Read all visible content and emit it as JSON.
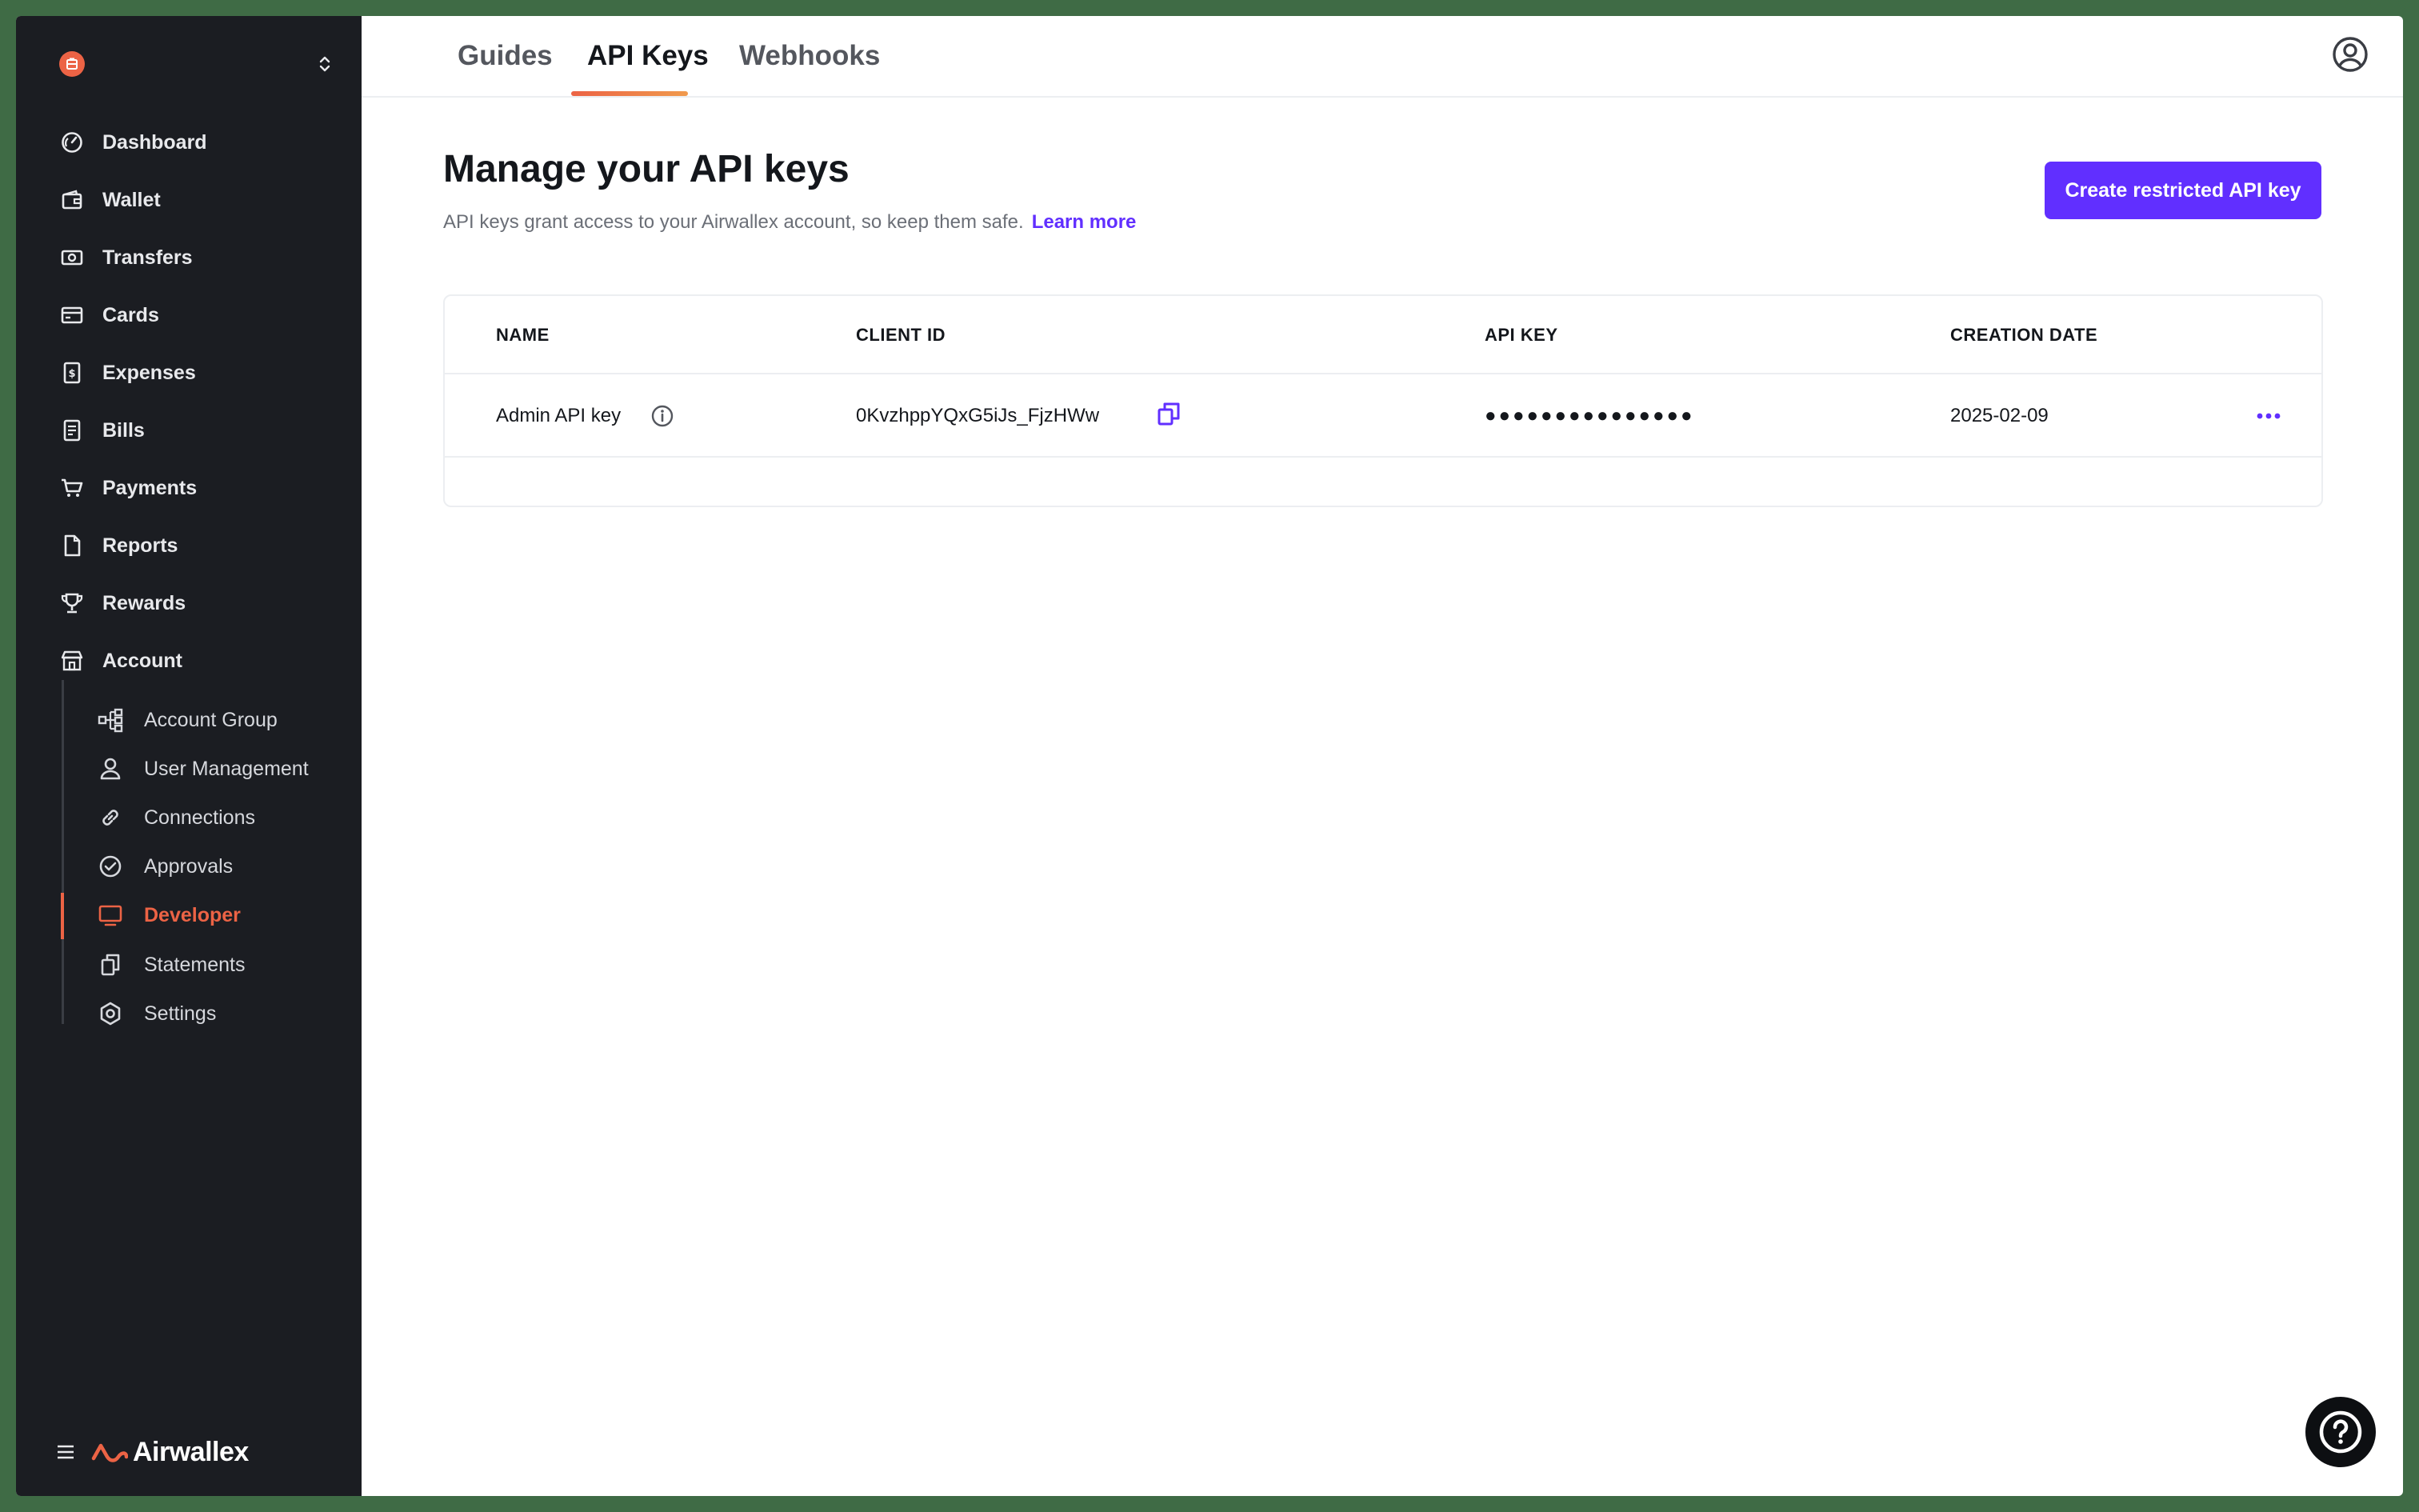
{
  "sidebar": {
    "org_icon": "building-icon",
    "switcher_icon": "chevron-up-down-icon",
    "items": [
      {
        "label": "Dashboard",
        "icon": "gauge-icon"
      },
      {
        "label": "Wallet",
        "icon": "wallet-icon"
      },
      {
        "label": "Transfers",
        "icon": "banknote-icon"
      },
      {
        "label": "Cards",
        "icon": "card-icon"
      },
      {
        "label": "Expenses",
        "icon": "receipt-dollar-icon"
      },
      {
        "label": "Bills",
        "icon": "bill-icon"
      },
      {
        "label": "Payments",
        "icon": "cart-icon"
      },
      {
        "label": "Reports",
        "icon": "document-icon"
      },
      {
        "label": "Rewards",
        "icon": "trophy-icon"
      },
      {
        "label": "Account",
        "icon": "storefront-icon"
      }
    ],
    "sub_items": [
      {
        "label": "Account Group",
        "icon": "hierarchy-icon"
      },
      {
        "label": "User Management",
        "icon": "user-icon"
      },
      {
        "label": "Connections",
        "icon": "link-icon"
      },
      {
        "label": "Approvals",
        "icon": "check-circle-icon"
      },
      {
        "label": "Developer",
        "icon": "monitor-icon",
        "active": true
      },
      {
        "label": "Statements",
        "icon": "copy-doc-icon"
      },
      {
        "label": "Settings",
        "icon": "settings-icon"
      }
    ],
    "brand": "Airwallex",
    "accent": "#ec6345"
  },
  "tabs": [
    {
      "label": "Guides"
    },
    {
      "label": "API Keys",
      "active": true
    },
    {
      "label": "Webhooks"
    }
  ],
  "page": {
    "title": "Manage your API keys",
    "subtitle": "API keys grant access to your Airwallex account, so keep them safe.",
    "learn_more": "Learn more",
    "create_button": "Create restricted API key",
    "primary_color": "#612fff"
  },
  "table": {
    "headers": {
      "name": "NAME",
      "client_id": "CLIENT ID",
      "api_key": "API KEY",
      "creation_date": "CREATION DATE"
    },
    "rows": [
      {
        "name": "Admin API key",
        "client_id": "0KvzhppYQxG5iJs_FjzHWw",
        "api_key": "●●●●●●●●●●●●●●●",
        "creation_date": "2025-02-09"
      }
    ]
  }
}
